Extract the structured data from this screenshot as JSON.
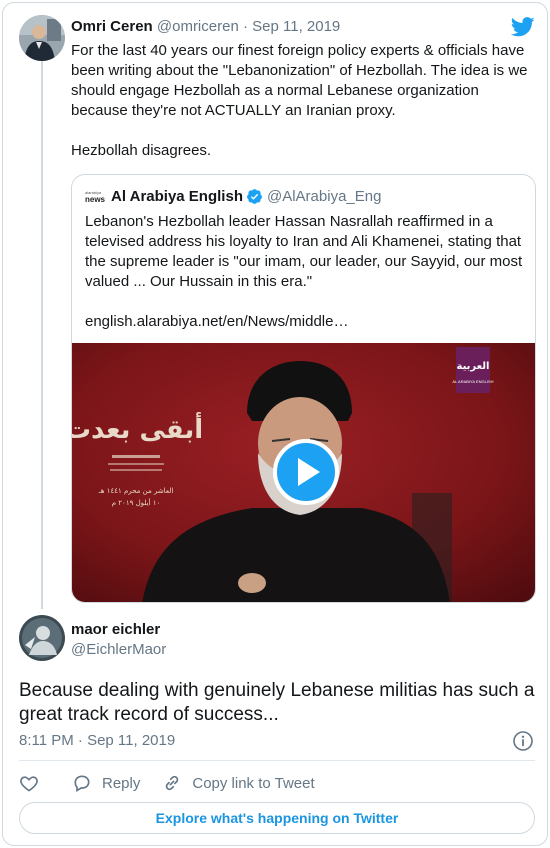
{
  "colors": {
    "accent": "#1da1f2",
    "link": "#1b95e0",
    "muted": "#657786",
    "border": "#cfd9de",
    "text": "#14171a"
  },
  "tweet": {
    "author_name": "Omri Ceren",
    "author_handle": "@omriceren",
    "separator": "·",
    "date": "Sep 11, 2019",
    "text_line1": "For the last 40 years our finest foreign policy experts & officials have been writing about the \"Lebanonization\" of Hezbollah. The idea is we should engage Hezbollah as a normal Lebanese organization because they're not ACTUALLY an Iranian proxy.",
    "text_line2": "Hezbollah disagrees."
  },
  "quoted": {
    "source_logo_text": "news",
    "source_logo_top": "alarabiya",
    "author_name": "Al Arabiya English",
    "author_handle": "@AlArabiya_Eng",
    "text": "Lebanon's Hezbollah leader Hassan Nasrallah reaffirmed in a televised address his loyalty to Iran and Ali Khamenei, stating that the supreme leader is \"our imam, our leader, our Sayyid, our most valued ... Our Hussain in this era.\"",
    "link": "english.alarabiya.net/en/News/middle…",
    "video": {
      "channel_logo_arabic": "العربية",
      "channel_logo_english": "AL ARABIYA ENGLISH",
      "banner_arabic_title": "أبقى بعدت",
      "banner_arabic_sub1": "العاشر من محرم ١٤٤١ هـ",
      "banner_arabic_sub2": "١٠ أيلول ٢٠١٩ م",
      "play_icon": "play-icon"
    }
  },
  "reply": {
    "author_name": "maor eichler",
    "author_handle": "@EichlerMaor",
    "text": "Because dealing with genuinely Lebanese militias has such a great track record of success...",
    "timestamp": "8:11 PM · Sep 11, 2019"
  },
  "actions": {
    "reply_label": "Reply",
    "copy_label": "Copy link to Tweet",
    "explore_label": "Explore what's happening on Twitter"
  }
}
